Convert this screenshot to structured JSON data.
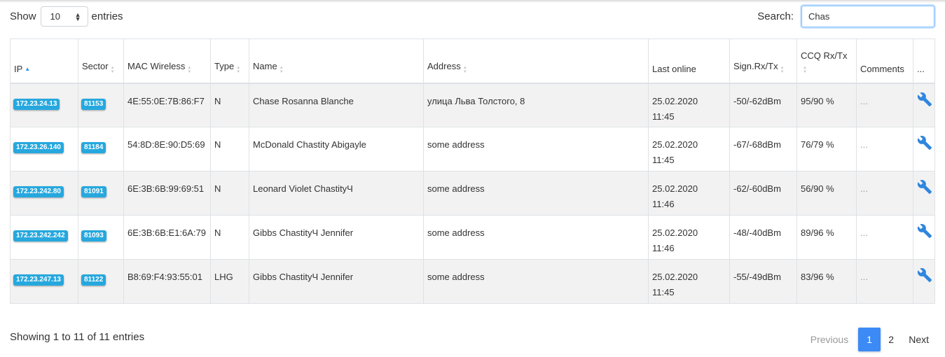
{
  "length_menu": {
    "prefix": "Show",
    "value": "10",
    "suffix": "entries"
  },
  "search": {
    "label": "Search:",
    "value": "Chas"
  },
  "columns": [
    {
      "label": "IP",
      "sort": "asc"
    },
    {
      "label": "Sector",
      "sort": "both"
    },
    {
      "label": "MAC Wireless",
      "sort": "both"
    },
    {
      "label": "Type",
      "sort": "both"
    },
    {
      "label": "Name",
      "sort": "both"
    },
    {
      "label": "Address",
      "sort": "both"
    },
    {
      "label": "Last online",
      "sort": "none"
    },
    {
      "label": "Sign.Rx/Tx",
      "sort": "both"
    },
    {
      "label": "CCQ Rx/Tx",
      "sort": "both"
    },
    {
      "label": "Comments",
      "sort": "none"
    },
    {
      "label": "...",
      "sort": "none"
    }
  ],
  "rows": [
    {
      "ip": "172.23.24.13",
      "sector": "81153",
      "mac": "4E:55:0E:7B:86:F7",
      "type": "N",
      "name": "Chase Rosanna Blanche",
      "address": "улица Льва Толстого, 8",
      "date": "25.02.2020",
      "time": "11:45",
      "signal": "-50/-62dBm",
      "ccq": "95/90 %",
      "comments": "..."
    },
    {
      "ip": "172.23.26.140",
      "sector": "81184",
      "mac": "54:8D:8E:90:D5:69",
      "type": "N",
      "name": "McDonald Chastity Abigayle",
      "address": "some address",
      "date": "25.02.2020",
      "time": "11:45",
      "signal": "-67/-68dBm",
      "ccq": "76/79 %",
      "comments": "..."
    },
    {
      "ip": "172.23.242.80",
      "sector": "81091",
      "mac": "6E:3B:6B:99:69:51",
      "type": "N",
      "name": "Leonard Violet ChastityЧ",
      "address": "some address",
      "date": "25.02.2020",
      "time": "11:46",
      "signal": "-62/-60dBm",
      "ccq": "56/90 %",
      "comments": "..."
    },
    {
      "ip": "172.23.242.242",
      "sector": "81093",
      "mac": "6E:3B:6B:E1:6A:79",
      "type": "N",
      "name": "Gibbs ChastityЧ Jennifer",
      "address": "some address",
      "date": "25.02.2020",
      "time": "11:46",
      "signal": "-48/-40dBm",
      "ccq": "89/96 %",
      "comments": "..."
    },
    {
      "ip": "172.23.247.13",
      "sector": "81122",
      "mac": "B8:69:F4:93:55:01",
      "type": "LHG",
      "name": "Gibbs ChastityЧ Jennifer",
      "address": "some address",
      "date": "25.02.2020",
      "time": "11:45",
      "signal": "-55/-49dBm",
      "ccq": "83/96 %",
      "comments": "..."
    }
  ],
  "info": "Showing 1 to 11 of 11 entries",
  "pagination": {
    "previous": "Previous",
    "pages": [
      "1",
      "2"
    ],
    "active": "1",
    "next": "Next"
  },
  "colors": {
    "badge": "#26a8de",
    "accent": "#3b8af5",
    "sort_active": "#2196f3",
    "stripe": "#f2f2f2"
  },
  "icons": {
    "action": "wrench-icon"
  }
}
